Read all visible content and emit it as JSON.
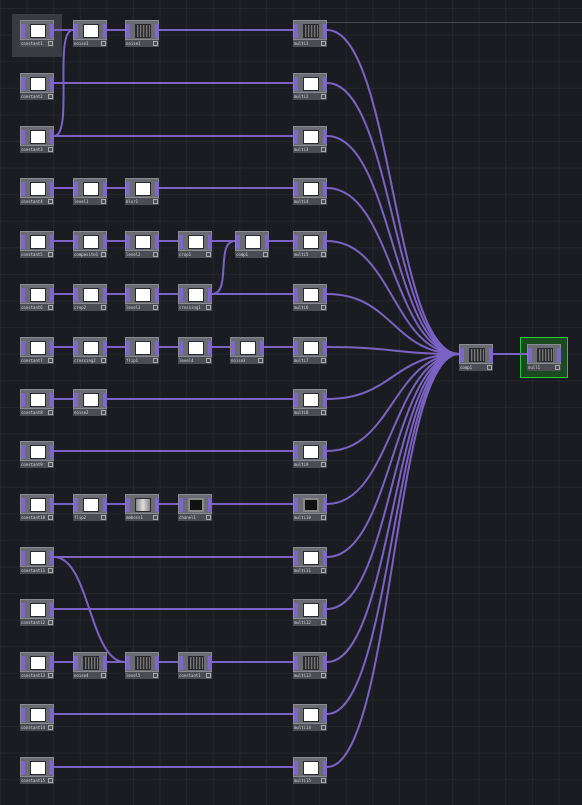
{
  "app": {
    "name": "node-network-editor"
  },
  "colors": {
    "wire": "#7a63c4",
    "background": "#1b1c21",
    "node": "#6b6b73",
    "output_highlight": "#25c93a"
  },
  "nodes": {
    "constant1": {
      "label": "constant1"
    },
    "noise1": {
      "label": "noise1"
    },
    "noise2_top": {
      "label": "noise1"
    },
    "constant2": {
      "label": "constant2"
    },
    "constant3": {
      "label": "constant3"
    },
    "constant4": {
      "label": "constant4"
    },
    "level1": {
      "label": "level1"
    },
    "blur1": {
      "label": "blur1"
    },
    "constant5": {
      "label": "constant5"
    },
    "composite1": {
      "label": "composite1"
    },
    "level2": {
      "label": "level2"
    },
    "crop1": {
      "label": "crop1"
    },
    "comp1": {
      "label": "comp1"
    },
    "constant6": {
      "label": "constant6"
    },
    "crop2": {
      "label": "crop2"
    },
    "level3": {
      "label": "level3"
    },
    "crossing1": {
      "label": "crossing1"
    },
    "constant7": {
      "label": "constant7"
    },
    "crossing2": {
      "label": "crossing2"
    },
    "flip1": {
      "label": "flip1"
    },
    "level4": {
      "label": "level4"
    },
    "noise3": {
      "label": "noise3"
    },
    "constant8": {
      "label": "constant8"
    },
    "noise2": {
      "label": "noise2"
    },
    "constant9": {
      "label": "constant9"
    },
    "constant10": {
      "label": "constant10"
    },
    "flip2": {
      "label": "flip2"
    },
    "emboss1": {
      "label": "emboss1"
    },
    "chanel1": {
      "label": "chanel1"
    },
    "constant11": {
      "label": "constant11"
    },
    "constant12": {
      "label": "constant12"
    },
    "constant13": {
      "label": "constant13"
    },
    "noise4": {
      "label": "noise4"
    },
    "level5": {
      "label": "level5"
    },
    "constant_b": {
      "label": "constant1"
    },
    "constant14": {
      "label": "constant14"
    },
    "constant15": {
      "label": "constant15"
    },
    "mult1": {
      "label": "multi1"
    },
    "mult2": {
      "label": "multi2"
    },
    "mult3": {
      "label": "multi3"
    },
    "mult4": {
      "label": "multi4"
    },
    "mult5": {
      "label": "multi5"
    },
    "mult6": {
      "label": "multi6"
    },
    "mult7": {
      "label": "multi7"
    },
    "mult8": {
      "label": "multi8"
    },
    "mult9": {
      "label": "multi9"
    },
    "mult10": {
      "label": "multi10"
    },
    "mult11": {
      "label": "multi11"
    },
    "mult12": {
      "label": "multi12"
    },
    "mult13": {
      "label": "multi13"
    },
    "mult14": {
      "label": "multi14"
    },
    "mult15": {
      "label": "multi15"
    },
    "mult16": {
      "label": "multi16"
    },
    "comp_main": {
      "label": "comp1"
    },
    "null_out": {
      "label": "null1"
    }
  }
}
